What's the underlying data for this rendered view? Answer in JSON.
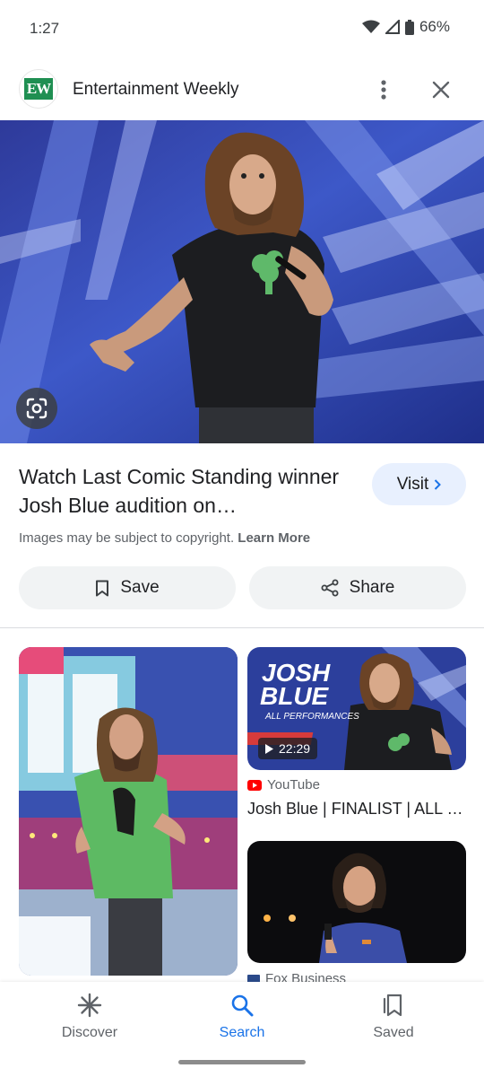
{
  "status_bar": {
    "time": "1:27",
    "battery": "66%"
  },
  "source": {
    "logo_text": "EW",
    "name": "Entertainment Weekly"
  },
  "result": {
    "title": "Watch Last Comic Standing winner Josh Blue audition on…",
    "visit_label": "Visit",
    "copyright_text": "Images may be subject to copyright.",
    "learn_more_label": "Learn More",
    "save_label": "Save",
    "share_label": "Share"
  },
  "related": [
    {
      "overlay_text": ""
    },
    {
      "overlay_line1": "JOSH",
      "overlay_line2": "BLUE",
      "overlay_line3": "ALL PERFORMANCES",
      "duration": "22:29",
      "source": "YouTube",
      "title": "Josh Blue | FINALIST | ALL …"
    },
    {
      "source": "Fox Business"
    }
  ],
  "nav": {
    "discover_label": "Discover",
    "search_label": "Search",
    "saved_label": "Saved",
    "active": "Search"
  },
  "colors": {
    "accent": "#1a73e8",
    "ew_green": "#1f8f52",
    "youtube_red": "#ff0000"
  }
}
